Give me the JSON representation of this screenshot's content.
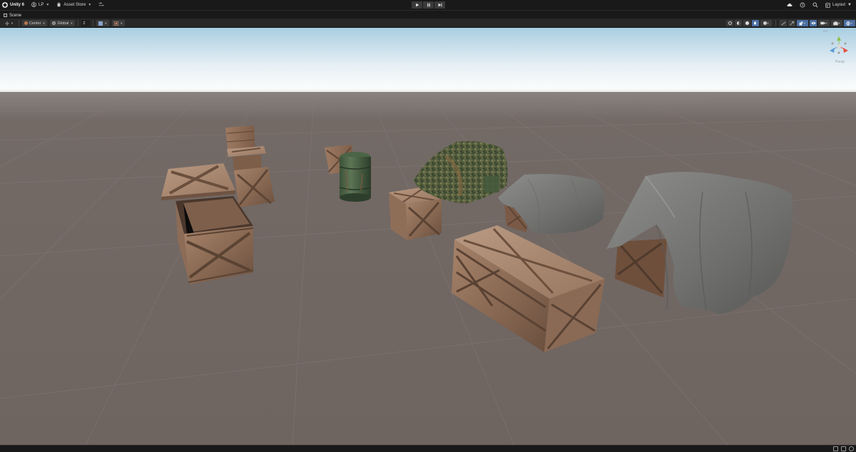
{
  "topbar": {
    "app_name": "Unity 6",
    "account_label": "LP",
    "asset_store_label": "Asset Store",
    "layout_label": "Layout"
  },
  "tab": {
    "scene_label": "Scene"
  },
  "scene_toolbar": {
    "pivot_label": "Center",
    "space_label": "Global",
    "snap_increment": "2"
  },
  "viewport": {
    "gizmo_mode": "Persp",
    "gizmo_top_label": "Iso"
  },
  "colors": {
    "chrome_dark": "#191919",
    "toolbar": "#282828",
    "ground": "#6e6561",
    "sky_top": "#a8cde0",
    "active_blue": "#4b6fa3"
  },
  "icons": [
    "unity-logo-icon",
    "account-icon",
    "asset-store-icon",
    "version-control-icon",
    "play-icon",
    "pause-icon",
    "step-icon",
    "cloud-icon",
    "history-icon",
    "search-icon",
    "layout-icon"
  ]
}
